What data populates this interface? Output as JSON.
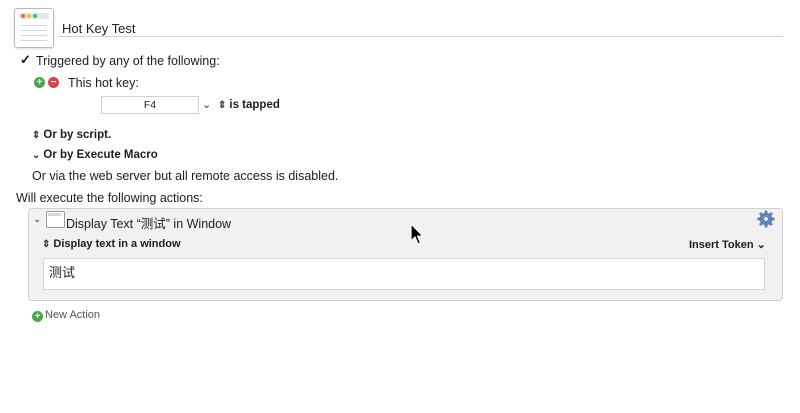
{
  "macro": {
    "title": "Hot Key Test"
  },
  "trigger": {
    "label": "Triggered by any of the following:",
    "hotkey_label": "This hot key:",
    "key_value": "F4",
    "key_state": "is tapped",
    "or_script": "Or by script.",
    "or_execute": "Or by Execute Macro",
    "web_server_note": "Or via the web server but all remote access is disabled."
  },
  "actions": {
    "header": "Will execute the following actions:",
    "items": [
      {
        "title": "Display Text “测试” in Window",
        "mode": "Display text in a window",
        "insert_token": "Insert Token",
        "text": "测试"
      }
    ],
    "new_action": "New Action"
  },
  "colors": {
    "add": "#4aa64a",
    "remove": "#d64545"
  },
  "icons": {
    "macro": "macro-window-icon",
    "action": "window-icon",
    "gear": "gear-icon",
    "add": "plus-circle-icon",
    "remove": "minus-circle-icon"
  }
}
